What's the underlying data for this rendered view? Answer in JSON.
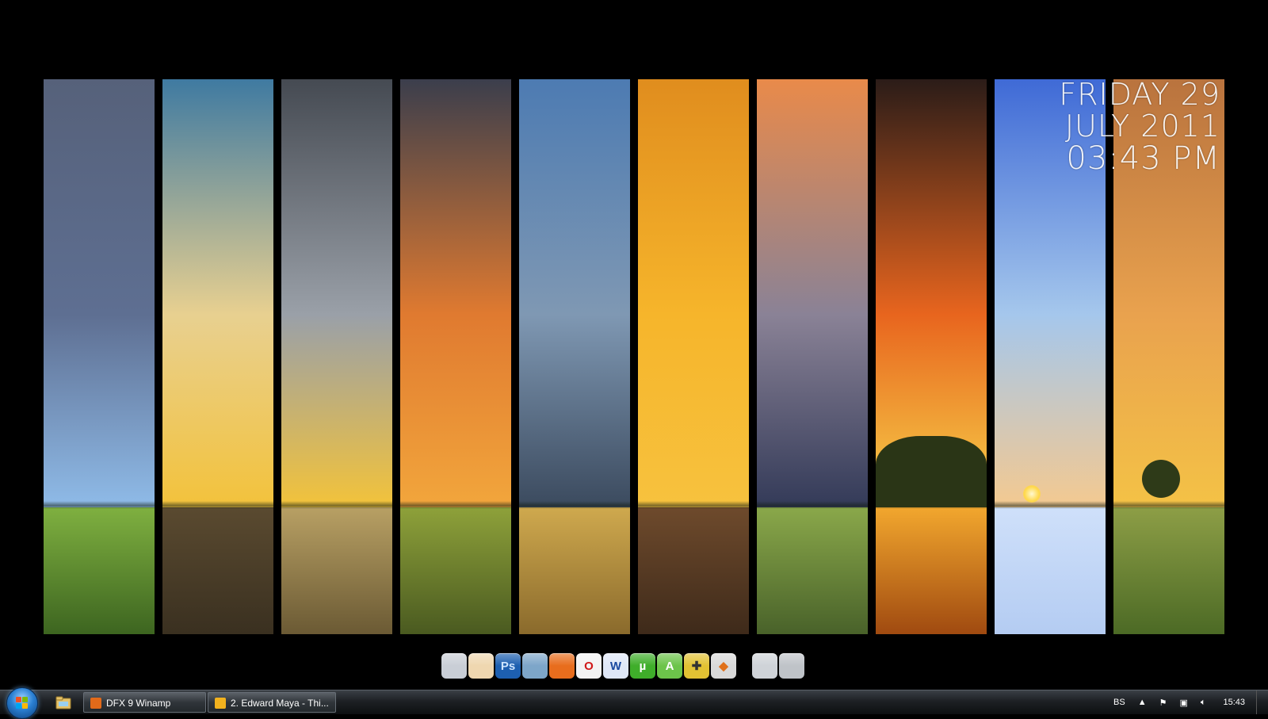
{
  "wallpaper": {
    "strips": [
      {
        "sky_top": "#56617a",
        "sky_mid": "#5e6f92",
        "sky_low": "#8fbbe8",
        "ground_top": "#7fb040",
        "ground_bot": "#3d6520"
      },
      {
        "sky_top": "#3f7aa1",
        "sky_mid": "#e8d090",
        "sky_low": "#f3c23b",
        "ground_top": "#5a4a30",
        "ground_bot": "#3a3020"
      },
      {
        "sky_top": "#454a52",
        "sky_mid": "#9aa0a8",
        "sky_low": "#f3c33a",
        "ground_top": "#b8a064",
        "ground_bot": "#6b5a34"
      },
      {
        "sky_top": "#3b3e4c",
        "sky_mid": "#e07a30",
        "sky_low": "#f2a63c",
        "ground_top": "#8ea13a",
        "ground_bot": "#4a5a20"
      },
      {
        "sky_top": "#4d7bb2",
        "sky_mid": "#7f98b3",
        "sky_low": "#3b4a5e",
        "ground_top": "#cfa94e",
        "ground_bot": "#8a6a2c"
      },
      {
        "sky_top": "#e08d1e",
        "sky_mid": "#f6b52b",
        "sky_low": "#f7c23e",
        "ground_top": "#6e4a2c",
        "ground_bot": "#3e2a1a"
      },
      {
        "sky_top": "#e98a4a",
        "sky_mid": "#8a8296",
        "sky_low": "#333a58",
        "ground_top": "#8aa84a",
        "ground_bot": "#49622a"
      },
      {
        "sky_top": "#2b1c18",
        "sky_mid": "#e8651e",
        "sky_low": "#f7d24a",
        "ground_top": "#f2a72e",
        "ground_bot": "#a04a10"
      },
      {
        "sky_top": "#3f6ad6",
        "sky_mid": "#a5c7ec",
        "sky_low": "#f4c990",
        "ground_top": "#cfe0fa",
        "ground_bot": "#b4ccf2"
      },
      {
        "sky_top": "#b9733e",
        "sky_mid": "#e9a24e",
        "sky_low": "#f4c246",
        "ground_top": "#8d9e46",
        "ground_bot": "#4c6a25"
      }
    ]
  },
  "clock": {
    "day": "FRIDAY 29",
    "month_year": "JULY 2011",
    "time": "03:43 PM"
  },
  "dock": {
    "icons": [
      {
        "name": "computer-icon",
        "label": "",
        "bg": "#c9ced6",
        "fg": "#222"
      },
      {
        "name": "folder-icon",
        "label": "",
        "bg": "#efd7b0",
        "fg": "#222"
      },
      {
        "name": "photoshop-icon",
        "label": "Ps",
        "bg": "#1d5fb0",
        "fg": "#cfe6ff"
      },
      {
        "name": "browser-globe-icon",
        "label": "",
        "bg": "#7da6c9",
        "fg": "#fff"
      },
      {
        "name": "firefox-icon",
        "label": "",
        "bg": "#e86d1d",
        "fg": "#fff"
      },
      {
        "name": "opera-icon",
        "label": "O",
        "bg": "#f3f3f3",
        "fg": "#d01818"
      },
      {
        "name": "word-icon",
        "label": "W",
        "bg": "#dfe7f7",
        "fg": "#1b4aa0"
      },
      {
        "name": "utorrent-icon",
        "label": "µ",
        "bg": "#3fae2a",
        "fg": "#fff"
      },
      {
        "name": "arrow-app-icon",
        "label": "A",
        "bg": "#6cc44a",
        "fg": "#fff"
      },
      {
        "name": "gamepad-icon",
        "label": "✚",
        "bg": "#e2c233",
        "fg": "#333"
      },
      {
        "name": "archive-icon",
        "label": "◆",
        "bg": "#d9d9d9",
        "fg": "#e0701a"
      },
      {
        "name": "steam-icon",
        "label": "",
        "bg": "#cfd3d8",
        "fg": "#222"
      },
      {
        "name": "trash-icon",
        "label": "",
        "bg": "#bfc3c8",
        "fg": "#333"
      }
    ]
  },
  "taskbar": {
    "tasks": [
      {
        "label": "DFX 9 Winamp",
        "icon_color": "#e26a1a"
      },
      {
        "label": "2. Edward Maya - Thi...",
        "icon_color": "#f2b21e"
      }
    ],
    "tray": {
      "language": "BS",
      "clock": "15:43"
    }
  }
}
